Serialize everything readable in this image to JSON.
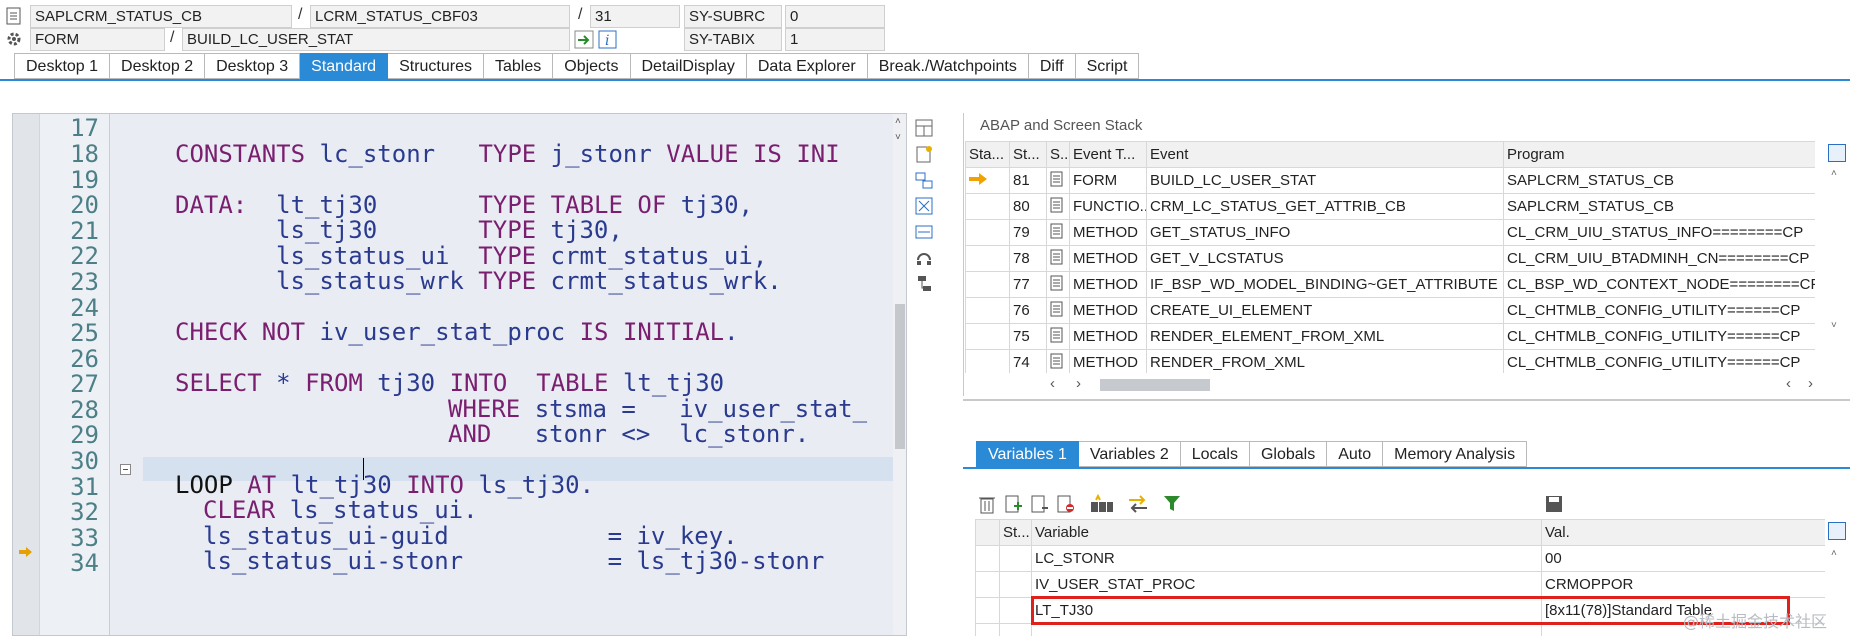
{
  "header": {
    "program": "SAPLCRM_STATUS_CB",
    "include": "LCRM_STATUS_CBF03",
    "line": "31",
    "subrc_label": "SY-SUBRC",
    "subrc_value": "0",
    "type": "FORM",
    "routine": "BUILD_LC_USER_STAT",
    "tabix_label": "SY-TABIX",
    "tabix_value": "1",
    "sep": "/"
  },
  "tabs": [
    "Desktop 1",
    "Desktop 2",
    "Desktop 3",
    "Standard",
    "Structures",
    "Tables",
    "Objects",
    "DetailDisplay",
    "Data Explorer",
    "Break./Watchpoints",
    "Diff",
    "Script"
  ],
  "active_tab": "Standard",
  "editor": {
    "line_numbers": [
      "17",
      "18",
      "19",
      "20",
      "21",
      "22",
      "23",
      "24",
      "25",
      "26",
      "27",
      "28",
      "29",
      "30",
      "31",
      "32",
      "33",
      "34"
    ],
    "lines": {
      "l18": {
        "kw1": "CONSTANTS",
        "t1": " lc_stonr   ",
        "kw2": "TYPE",
        "t2": " j_stonr ",
        "kw3": "VALUE IS INI"
      },
      "l20": {
        "kw1": "DATA:",
        "t1": "  lt_tj30       ",
        "kw2": "TYPE TABLE OF",
        "t2": " tj30,"
      },
      "l21": {
        "t1": "ls_tj30       ",
        "kw1": "TYPE",
        "t2": " tj30,"
      },
      "l22": {
        "t1": "ls_status_ui  ",
        "kw1": "TYPE",
        "t2": " crmt_status_ui,"
      },
      "l23": {
        "t1": "ls_status_wrk ",
        "kw1": "TYPE",
        "t2": " crmt_status_wrk."
      },
      "l25": {
        "kw1": "CHECK NOT",
        "t1": " iv_user_stat_proc ",
        "kw2": "IS INITIAL",
        "t2": "."
      },
      "l27": {
        "kw1": "SELECT",
        "t1": " * ",
        "kw2": "FROM",
        "t2": " tj30 ",
        "kw3": "INTO  TABLE",
        "t3": " lt_tj30"
      },
      "l28": {
        "kw1": "WHERE",
        "t1": " stsma =   iv_user_stat_"
      },
      "l29": {
        "kw1": "AND",
        "t1": "   stonr <>  lc_stonr."
      },
      "l31": {
        "kw1": "LOOP",
        "kw2": "AT",
        "t1": " lt_tj30 ",
        "kw3": "INTO",
        "t2": " ls_tj30."
      },
      "l32": {
        "kw1": "CLEAR",
        "t1": " ls_status_ui."
      },
      "l33": {
        "t1": "ls_status_ui-guid           = iv_key."
      },
      "l34": {
        "t1": "ls_status_ui-stonr          = ls_tj30-stonr"
      }
    }
  },
  "stack": {
    "title": "ABAP and Screen Stack",
    "columns": [
      "Sta...",
      "St...",
      "S..",
      "Event T...",
      "Event",
      "Program"
    ],
    "rows": [
      {
        "level": "81",
        "type": "FORM",
        "event": "BUILD_LC_USER_STAT",
        "program": "SAPLCRM_STATUS_CB",
        "current": true
      },
      {
        "level": "80",
        "type": "FUNCTIO...",
        "event": "CRM_LC_STATUS_GET_ATTRIB_CB",
        "program": "SAPLCRM_STATUS_CB"
      },
      {
        "level": "79",
        "type": "METHOD",
        "event": "GET_STATUS_INFO",
        "program": "CL_CRM_UIU_STATUS_INFO========CP"
      },
      {
        "level": "78",
        "type": "METHOD",
        "event": "GET_V_LCSTATUS",
        "program": "CL_CRM_UIU_BTADMINH_CN========CP"
      },
      {
        "level": "77",
        "type": "METHOD",
        "event": "IF_BSP_WD_MODEL_BINDING~GET_ATTRIBUTE",
        "program": "CL_BSP_WD_CONTEXT_NODE========CP"
      },
      {
        "level": "76",
        "type": "METHOD",
        "event": "CREATE_UI_ELEMENT",
        "program": "CL_CHTMLB_CONFIG_UTILITY======CP"
      },
      {
        "level": "75",
        "type": "METHOD",
        "event": "RENDER_ELEMENT_FROM_XML",
        "program": "CL_CHTMLB_CONFIG_UTILITY======CP"
      },
      {
        "level": "74",
        "type": "METHOD",
        "event": "RENDER_FROM_XML",
        "program": "CL_CHTMLB_CONFIG_UTILITY======CP"
      }
    ]
  },
  "var_tabs": [
    "Variables 1",
    "Variables 2",
    "Locals",
    "Globals",
    "Auto",
    "Memory Analysis"
  ],
  "variables": {
    "columns": [
      "St...",
      "Variable",
      "Val."
    ],
    "rows": [
      {
        "name": "LC_STONR",
        "value": "00"
      },
      {
        "name": "IV_USER_STAT_PROC",
        "value": "CRMOPPOR"
      },
      {
        "name": "LT_TJ30",
        "value": "[8x11(78)]Standard Table",
        "highlighted": true
      }
    ]
  },
  "watermark": "@稀土掘金技术社区",
  "colors": {
    "accent": "#2b8ad6",
    "keyword": "#7a1e6f",
    "highlight_box": "#e0201c"
  }
}
